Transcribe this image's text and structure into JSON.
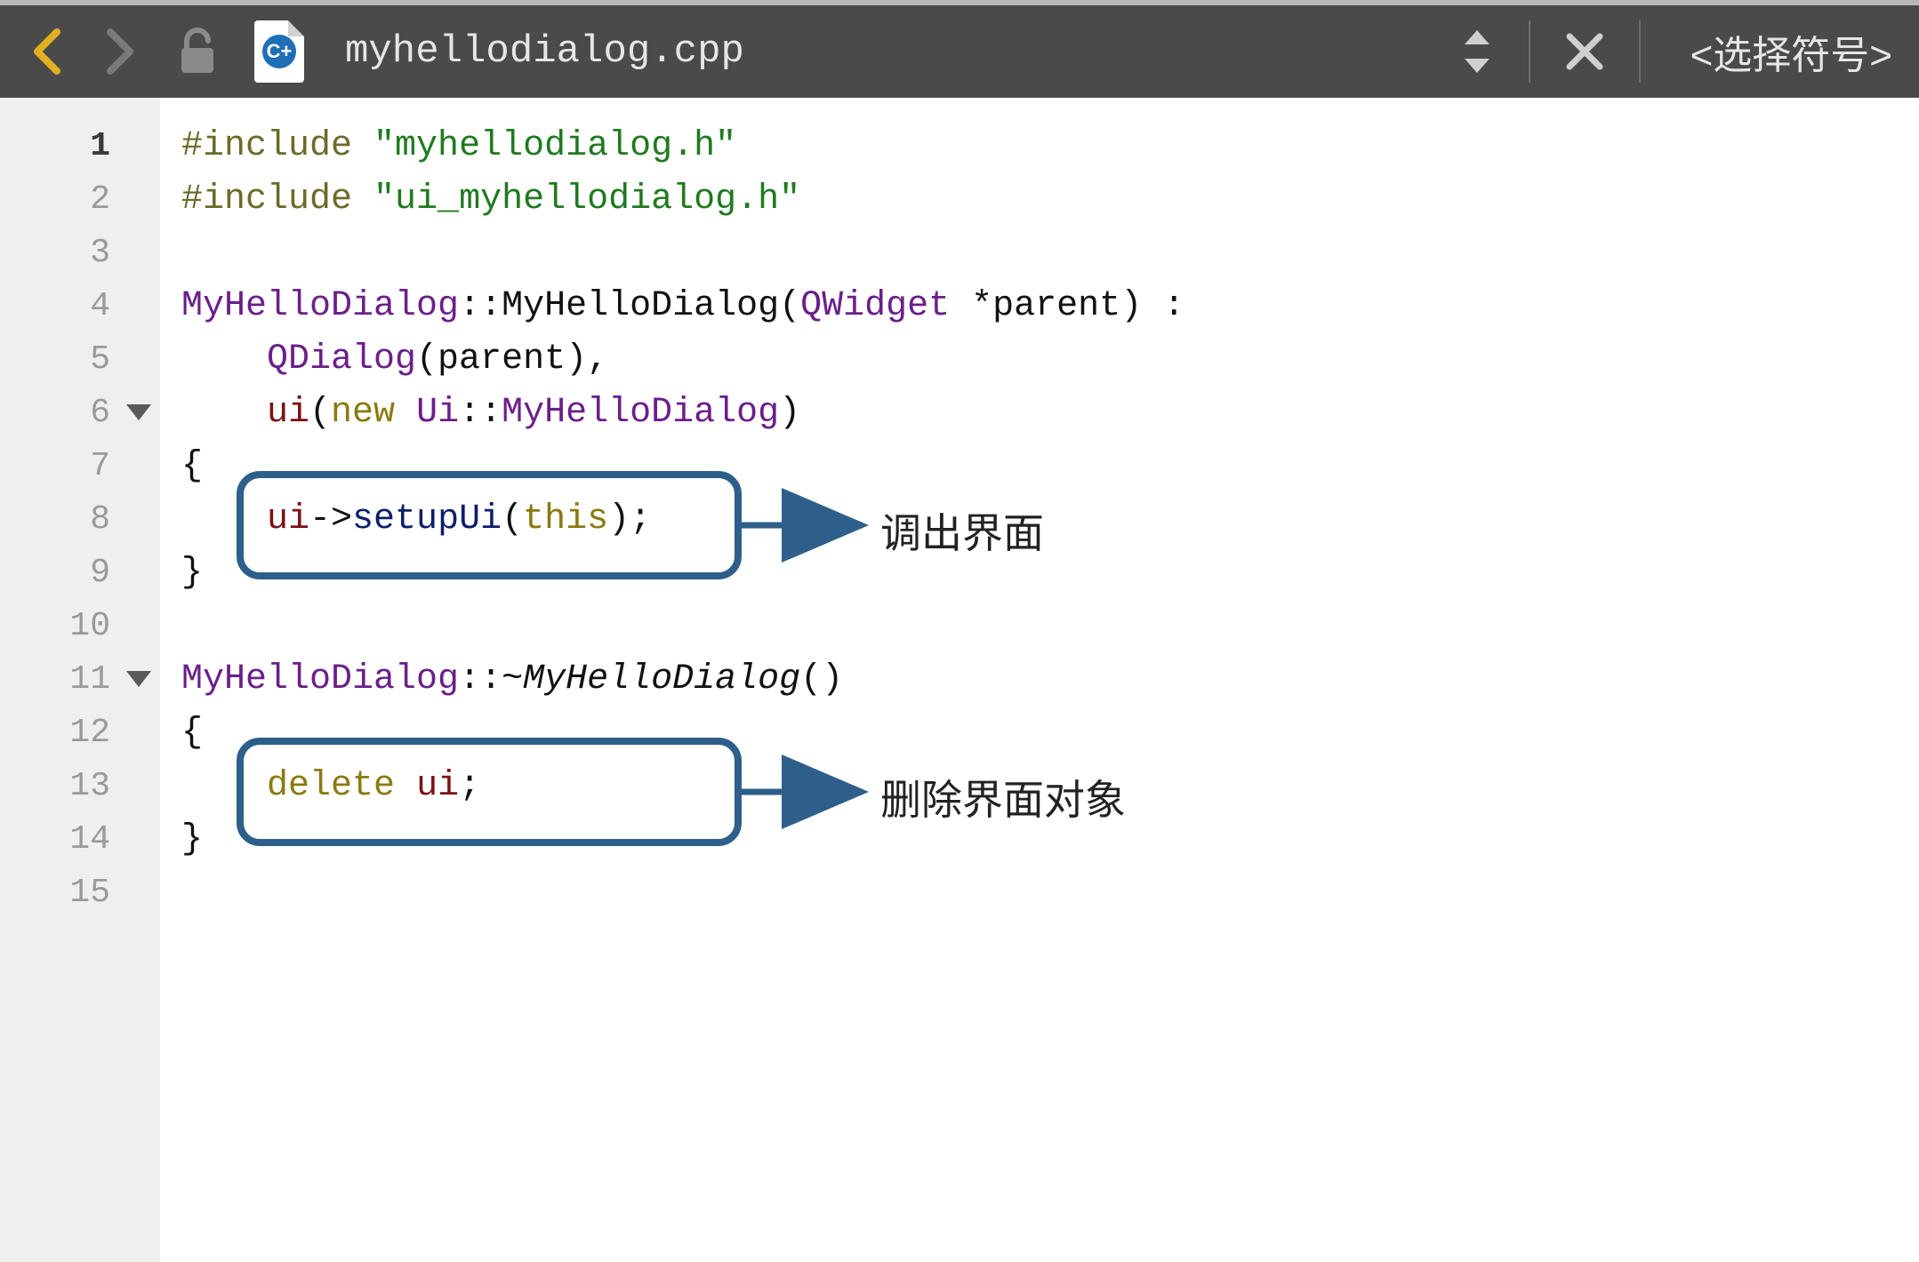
{
  "toolbar": {
    "filename": "myhellodialog.cpp",
    "symbol_picker": "<选择符号>",
    "icons": {
      "back": "back-icon",
      "forward": "forward-icon",
      "lock": "unlock-icon",
      "filetype": "cpp-file-icon",
      "stepper": "stepper-icon",
      "close": "close-icon"
    }
  },
  "gutter": {
    "lines": [
      "1",
      "2",
      "3",
      "4",
      "5",
      "6",
      "7",
      "8",
      "9",
      "10",
      "11",
      "12",
      "13",
      "14",
      "15"
    ],
    "dark_lines": [
      1
    ],
    "fold_lines": [
      6,
      11
    ]
  },
  "code": {
    "lines": [
      [
        {
          "cls": "tok-olive",
          "t": "#include "
        },
        {
          "cls": "tok-green",
          "t": "\"myhellodialog.h\""
        }
      ],
      [
        {
          "cls": "tok-olive",
          "t": "#include "
        },
        {
          "cls": "tok-green",
          "t": "\"ui_myhellodialog.h\""
        }
      ],
      [],
      [
        {
          "cls": "tok-purple",
          "t": "MyHelloDialog"
        },
        {
          "cls": "tok-black",
          "t": "::MyHelloDialog("
        },
        {
          "cls": "tok-purple",
          "t": "QWidget"
        },
        {
          "cls": "tok-black",
          "t": " *parent) :"
        }
      ],
      [
        {
          "cls": "tok-black",
          "t": "    "
        },
        {
          "cls": "tok-purple",
          "t": "QDialog"
        },
        {
          "cls": "tok-black",
          "t": "(parent),"
        }
      ],
      [
        {
          "cls": "tok-black",
          "t": "    "
        },
        {
          "cls": "tok-maroon",
          "t": "ui"
        },
        {
          "cls": "tok-black",
          "t": "("
        },
        {
          "cls": "tok-gold",
          "t": "new"
        },
        {
          "cls": "tok-black",
          "t": " "
        },
        {
          "cls": "tok-purple",
          "t": "Ui"
        },
        {
          "cls": "tok-black",
          "t": "::"
        },
        {
          "cls": "tok-purple",
          "t": "MyHelloDialog"
        },
        {
          "cls": "tok-black",
          "t": ")"
        }
      ],
      [
        {
          "cls": "tok-black",
          "t": "{"
        }
      ],
      [
        {
          "cls": "tok-black",
          "t": "    "
        },
        {
          "cls": "tok-maroon",
          "t": "ui"
        },
        {
          "cls": "tok-black",
          "t": "->"
        },
        {
          "cls": "tok-navy",
          "t": "setupUi"
        },
        {
          "cls": "tok-black",
          "t": "("
        },
        {
          "cls": "tok-gold",
          "t": "this"
        },
        {
          "cls": "tok-black",
          "t": ");"
        }
      ],
      [
        {
          "cls": "tok-black",
          "t": "}"
        }
      ],
      [],
      [
        {
          "cls": "tok-purple",
          "t": "MyHelloDialog"
        },
        {
          "cls": "tok-black",
          "t": "::~"
        },
        {
          "cls": "tok-black italic",
          "t": "MyHelloDialog"
        },
        {
          "cls": "tok-black",
          "t": "()"
        }
      ],
      [
        {
          "cls": "tok-black",
          "t": "{"
        }
      ],
      [
        {
          "cls": "tok-black",
          "t": "    "
        },
        {
          "cls": "tok-gold",
          "t": "delete"
        },
        {
          "cls": "tok-black",
          "t": " "
        },
        {
          "cls": "tok-maroon",
          "t": "ui"
        },
        {
          "cls": "tok-black",
          "t": ";"
        }
      ],
      [
        {
          "cls": "tok-black",
          "t": "}"
        }
      ],
      []
    ]
  },
  "annotations": {
    "a1": "调出界面",
    "a2": "删除界面对象"
  },
  "colors": {
    "toolbar_bg": "#4a4a4a",
    "gutter_bg": "#efefef",
    "accent_yellow": "#e0b020",
    "annotation_blue": "#2e5f8a"
  }
}
